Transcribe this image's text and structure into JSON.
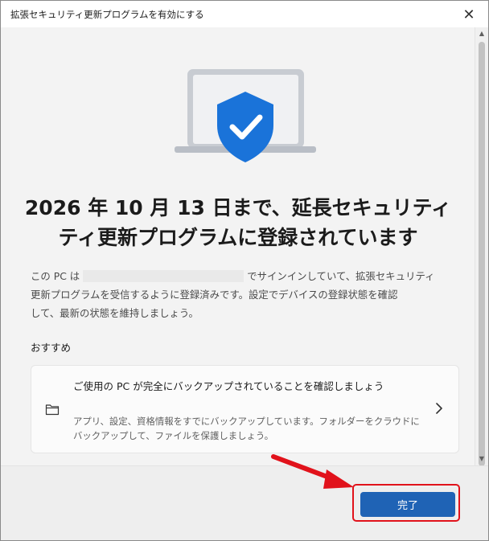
{
  "window": {
    "title": "拡張セキュリティ更新プログラムを有効にする",
    "close_label": "✕"
  },
  "main": {
    "heading_line1": "2026 年 10 月 13 日まで、延長セキュリティ",
    "heading_line2": "ティ更新プログラムに登録されています",
    "desc_prefix": "この PC は",
    "desc_suffix": "でサインインしていて、拡張セキュリティ",
    "desc_line2": "更新プログラムを受信するように登録済みです。設定でデバイスの登録状態を確認",
    "desc_line3": "して、最新の状態を維持しましょう。",
    "section_label": "おすすめ"
  },
  "card": {
    "title": "ご使用の PC が完全にバックアップされていることを確認しましょう",
    "desc": "アプリ、設定、資格情報をすでにバックアップしています。フォルダーをクラウドにバックアップして、ファイルを保護しましょう。",
    "icon": "folder-icon"
  },
  "footer": {
    "done_label": "完了"
  },
  "colors": {
    "accent": "#1f63b5",
    "shield": "#1a73d9",
    "annotation": "#e1121b"
  }
}
